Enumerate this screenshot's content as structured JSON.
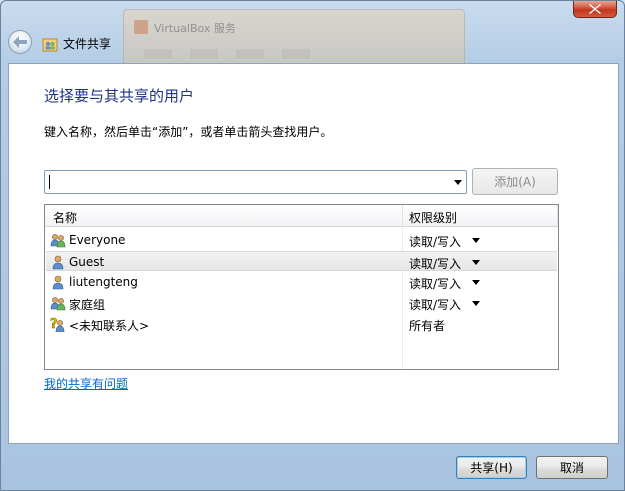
{
  "window": {
    "title": "文件共享",
    "background_window_title": "VirtualBox 服务"
  },
  "heading": "选择要与其共享的用户",
  "instruction": "键入名称，然后单击“添加”，或者单击箭头查找用户。",
  "name_input": {
    "value": "",
    "placeholder": ""
  },
  "add_button": "添加(A)",
  "list": {
    "columns": [
      "名称",
      "权限级别"
    ],
    "rows": [
      {
        "icon": "group-icon",
        "name": "Everyone",
        "permission": "读取/写入",
        "has_dropdown": true,
        "selected": false
      },
      {
        "icon": "user-icon",
        "name": "Guest",
        "permission": "读取/写入",
        "has_dropdown": true,
        "selected": true
      },
      {
        "icon": "user-icon",
        "name": "liutengteng",
        "permission": "读取/写入",
        "has_dropdown": true,
        "selected": false
      },
      {
        "icon": "group-icon",
        "name": "家庭组",
        "permission": "读取/写入",
        "has_dropdown": true,
        "selected": false
      },
      {
        "icon": "unknown-contact-icon",
        "name": "<未知联系人>",
        "permission": "所有者",
        "has_dropdown": false,
        "selected": false
      }
    ]
  },
  "help_link": "我的共享有问题",
  "footer": {
    "share_button": "共享(H)",
    "cancel_button": "取消"
  },
  "colors": {
    "heading": "#1e3287",
    "link": "#0066cc",
    "close": "#c2351c"
  }
}
